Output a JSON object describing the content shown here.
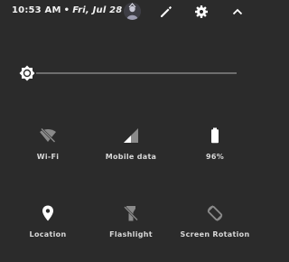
{
  "status_bar": {
    "time": "10:53 AM",
    "separator": "•",
    "date": "Fri, Jul 28",
    "avatar_icon": "user-avatar",
    "edit_icon": "pencil-icon",
    "settings_icon": "gear-icon",
    "collapse_icon": "chevron-up-icon"
  },
  "brightness": {
    "icon": "brightness-icon",
    "level": 0
  },
  "tiles": [
    {
      "label": "Wi-Fi",
      "icon": "wifi-off-icon",
      "active": false
    },
    {
      "label": "Mobile data",
      "icon": "signal-icon",
      "active": false
    },
    {
      "label": "96%",
      "icon": "battery-icon",
      "active": true
    },
    {
      "label": "Location",
      "icon": "location-pin-icon",
      "active": true
    },
    {
      "label": "Flashlight",
      "icon": "flashlight-off-icon",
      "active": false
    },
    {
      "label": "Screen Rotation",
      "icon": "screen-rotation-icon",
      "active": false
    }
  ],
  "colors": {
    "background": "#2b2b2b",
    "active_icon": "#ffffff",
    "inactive_icon": "#8a8a8a",
    "label": "#d8d8d8"
  }
}
